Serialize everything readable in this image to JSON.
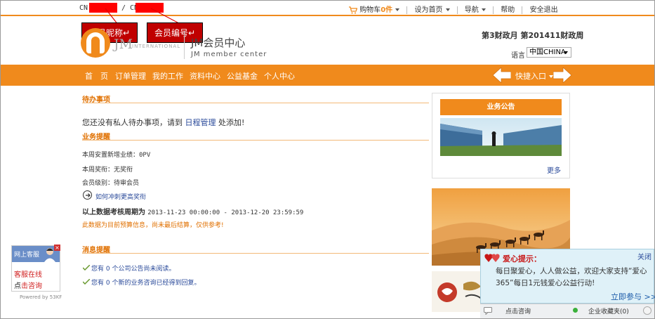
{
  "topbar": {
    "cn1": "CN",
    "cn2": "/ CN",
    "cart_label": "购物车",
    "cart_count": "0",
    "cart_unit": "件",
    "set_home": "设为首页",
    "nav": "导航",
    "help": "帮助",
    "logout": "安全退出"
  },
  "annotations": {
    "nickname": "会员昵称↵",
    "number": "会员编号↵"
  },
  "header": {
    "logo_jm": "JM",
    "logo_intl": "INTERNATIONAL",
    "center_cn": "JM会员中心",
    "center_en": "JM member center",
    "period": "第3财政月  第201411财政周",
    "lang_label": "语言",
    "lang_value": "中国CHINA"
  },
  "nav": {
    "items": [
      "首　页",
      "订单管理",
      "我的工作",
      "资料中心",
      "公益基金",
      "个人中心"
    ],
    "quick": "快捷入口"
  },
  "todo": {
    "title": "待办事项",
    "text_before": "您还没有私人待办事项，请到",
    "link": "日程管理",
    "text_after": "处添加!"
  },
  "business": {
    "title": "业务提醒",
    "line1": "本周安置新增业绩：0PV",
    "line2": "本周奖衔：无奖衔",
    "line3": "会员级别：待审会员",
    "how_link": "如何冲刺更高奖衔",
    "period_label": "以上数据考核周期为",
    "period_value": "2013-11-23 00:00:00 - 2013-12-20 23:59:59",
    "note": "此数据为目前预算信息，尚未最后结算，仅供参考!"
  },
  "messages": {
    "title": "消息提醒",
    "line1": "您有 0 个公司公告尚未阅读。",
    "line2": "您有 0 个新的业务咨询已经得到回复。"
  },
  "right": {
    "notice_title": "业务公告",
    "more": "更多"
  },
  "chat": {
    "head": "网上客服",
    "online": "客服在线",
    "consult_pre": "点",
    "consult_hl": "击咨询",
    "powered": "Powered by 53KF"
  },
  "love": {
    "title": "爱心提示：",
    "close": "关闭",
    "text": "每日聚爱心，人人做公益，欢迎大家支持“爱心365”每日1元钱爱心公益行动!",
    "join": "立即参与 >>",
    "bar_consult": "点击咨询",
    "bar_favorites": "企业收藏夹(0)"
  },
  "colors": {
    "brand_orange": "#f08a1c",
    "annotation_red": "#c00000",
    "link_blue": "#2a4a9a"
  }
}
